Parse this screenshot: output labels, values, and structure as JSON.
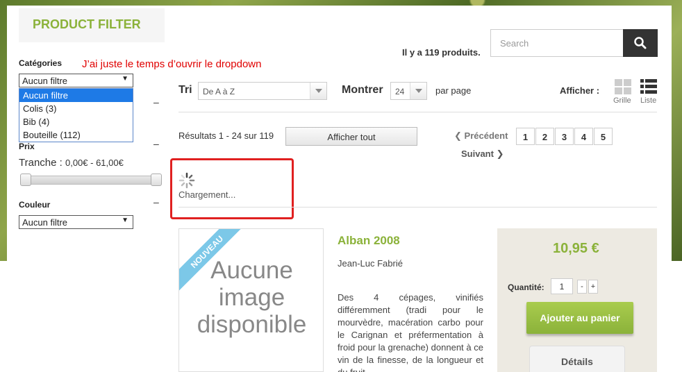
{
  "filter": {
    "title": "PRODUCT FILTER",
    "annotation": "J’ai juste le temps d’ouvrir le dropdown",
    "categories": {
      "label": "Catégories",
      "selected": "Aucun filtre",
      "options": [
        "Aucun filtre",
        "Colis (3)",
        "Bib (4)",
        "Bouteille (112)"
      ]
    },
    "price": {
      "label": "Prix",
      "range_label": "Tranche :",
      "range_value": "0,00€ - 61,00€",
      "min_fraction": 0,
      "max_fraction": 1
    },
    "color": {
      "label": "Couleur",
      "selected": "Aucun filtre"
    },
    "collapse_symbol": "–"
  },
  "search": {
    "placeholder": "Search",
    "icon": "search-icon"
  },
  "product_count": "Il y a 119 produits.",
  "sort": {
    "label": "Tri",
    "selected": "De A à Z"
  },
  "show": {
    "label": "Montrer",
    "selected": "24",
    "suffix": "par page"
  },
  "view": {
    "label": "Afficher :",
    "grid_label": "Grille",
    "list_label": "Liste",
    "active": "list"
  },
  "results": {
    "text": "Résultats 1 - 24 sur 119",
    "show_all": "Afficher tout"
  },
  "pagination": {
    "prev": "Précédent",
    "next": "Suivant",
    "pages": [
      "1",
      "2",
      "3",
      "4",
      "5"
    ]
  },
  "loading": {
    "text": "Chargement..."
  },
  "product": {
    "ribbon": "NOUVEAU",
    "no_image": "Aucune image disponible",
    "name": "Alban 2008",
    "producer": "Jean-Luc Fabrié",
    "description": "Des 4 cépages, vinifiés différemment (tradi pour le mourvèdre, macération carbo pour le Carignan et préfermentation à froid pour la grenache) donnent à ce vin de la finesse, de la longueur et du fruit.",
    "price": "10,95 €",
    "quantity_label": "Quantité:",
    "quantity": "1",
    "minus": "-",
    "plus": "+",
    "add_to_cart": "Ajouter au panier",
    "details": "Détails"
  },
  "colors": {
    "accent_green": "#8bb23a",
    "annotation_red": "#e00000",
    "dropdown_highlight": "#1e7ae6"
  }
}
